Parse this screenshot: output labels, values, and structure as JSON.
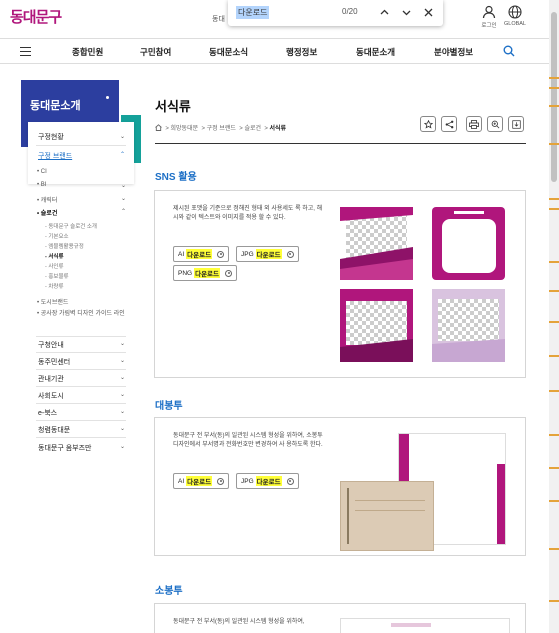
{
  "header": {
    "logo": "동대문구",
    "hidden_nav": "동대",
    "find": {
      "query": "다운로드",
      "count": "0/20"
    },
    "login": "로그인",
    "global": "GLOBAL"
  },
  "nav": {
    "items": [
      "종합민원",
      "구민참여",
      "동대문소식",
      "행정정보",
      "동대문소개",
      "분야별정보"
    ]
  },
  "sidebar": {
    "title": "동대문소개",
    "items": [
      {
        "label": "구정현황"
      },
      {
        "label": "구정 브랜드"
      }
    ],
    "sub": [
      "CI",
      "BI",
      "캐릭터",
      "슬로건"
    ],
    "sub2": [
      "동대문구 슬로건 소개",
      "기본요소",
      "엠블렘활용규정",
      "서식류",
      "사인류",
      "홍보물류",
      "차량류"
    ],
    "sub3": [
      "도시브랜드",
      "공사장 가림벽 디자인 가이드 라인"
    ],
    "more": [
      "구청안내",
      "동주민센터",
      "관내기관",
      "사회도시",
      "e-북스",
      "청렴동대문",
      "동대문구 옴부즈만"
    ]
  },
  "content": {
    "title": "서식류",
    "breadcrumb": [
      "희망동대문",
      "구정 브랜드",
      "슬로건",
      "서식류"
    ],
    "sections": [
      {
        "title": "SNS 활용",
        "desc": "제시된 포맷을 기준으로 정해진 형태 외 사용세도 록 하고, 해시와 같이 텍스트와 이미지를 적용 할 수 있다.",
        "buttons": [
          {
            "prefix": "AI",
            "label": "다운로드"
          },
          {
            "prefix": "JPG",
            "label": "다운로드"
          },
          {
            "prefix": "PNG",
            "label": "다운로드"
          }
        ]
      },
      {
        "title": "대봉투",
        "desc": "동대문구 전 부서(동)의 일관된 시스템 형성을 위하여, 소봉투 디자인에서 부서명과 전화번호만 변경하여 사 용하도록 한다.",
        "buttons": [
          {
            "prefix": "AI",
            "label": "다운로드"
          },
          {
            "prefix": "JPG",
            "label": "다운로드"
          }
        ]
      },
      {
        "title": "소봉투",
        "desc": "동대문구 전 부서(동)의 일관된 시스템 형성을 위하여,",
        "buttons": []
      }
    ]
  },
  "colors": {
    "brand": "#b0167c",
    "navy": "#2c3e9f",
    "teal": "#14a19a",
    "link": "#1c6fc6",
    "highlight": "#ffff38"
  }
}
